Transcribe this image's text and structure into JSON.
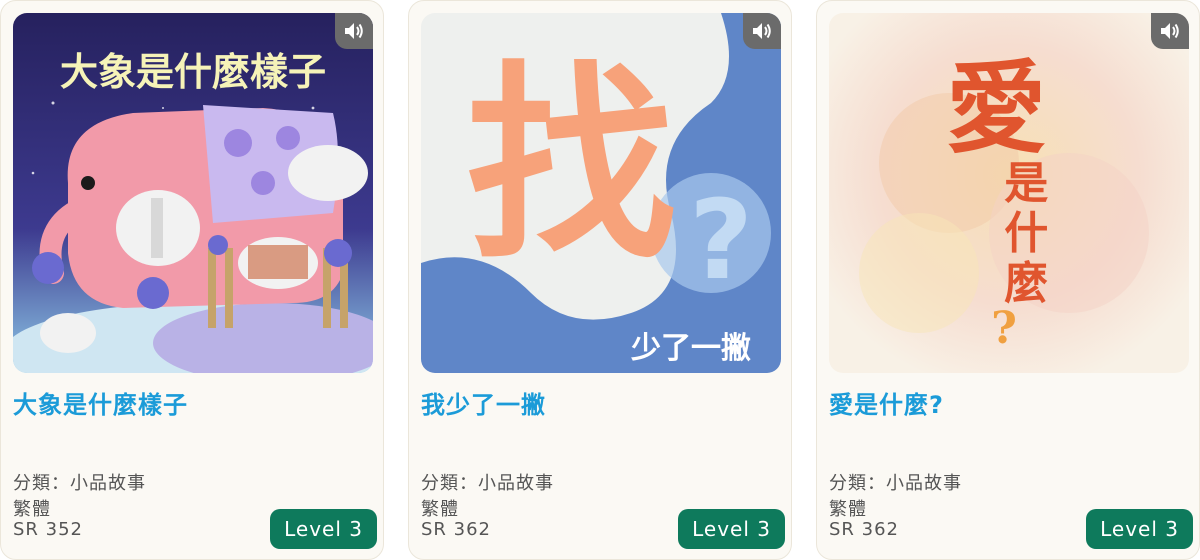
{
  "books": [
    {
      "cover_title": "大象是什麼樣子",
      "title": "大象是什麼樣子",
      "category": "分類：小品故事",
      "script": "繁體",
      "sr": "SR 352",
      "level": "Level 3",
      "audio_icon": "speaker-icon"
    },
    {
      "cover_title": "找",
      "cover_subtitle": "少了一撇",
      "title": "我少了一撇",
      "category": "分類：小品故事",
      "script": "繁體",
      "sr": "SR 362",
      "level": "Level 3",
      "audio_icon": "speaker-icon"
    },
    {
      "cover_title": "愛是什麼?",
      "title": "愛是什麼?",
      "category": "分類：小品故事",
      "script": "繁體",
      "sr": "SR 362",
      "level": "Level 3",
      "audio_icon": "speaker-icon"
    }
  ],
  "colors": {
    "title": "#1b9bd8",
    "level_badge": "#0e7a5c",
    "card_bg": "#fbf9f4"
  }
}
